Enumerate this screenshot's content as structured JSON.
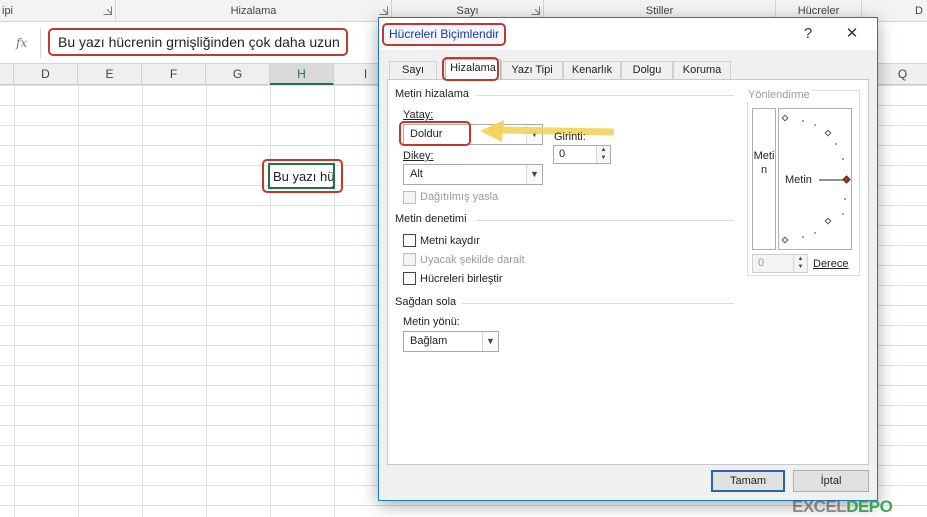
{
  "ribbon": {
    "groups": [
      {
        "label": "ipi",
        "launcher": true
      },
      {
        "label": "Hizalama",
        "launcher": true
      },
      {
        "label": "Sayı",
        "launcher": true
      },
      {
        "label": "Stiller",
        "launcher": false
      },
      {
        "label": "Hücreler",
        "launcher": false
      },
      {
        "label": "D",
        "launcher": false
      }
    ]
  },
  "formula_bar": {
    "fx_label": "fx",
    "value": "Bu yazı hücrenin grnişliğinden çok daha uzun"
  },
  "columns": [
    "D",
    "E",
    "F",
    "G",
    "H",
    "I"
  ],
  "right_columns": [
    "Q"
  ],
  "selected_column": "H",
  "active_cell": {
    "display_text": "Bu yazı hü"
  },
  "dialog": {
    "title": "Hücreleri Biçimlendir",
    "help_label": "?",
    "close_label": "✕",
    "tabs": [
      "Sayı",
      "Hizalama",
      "Yazı Tipi",
      "Kenarlık",
      "Dolgu",
      "Koruma"
    ],
    "active_tab": "Hizalama",
    "text_alignment": {
      "section_title": "Metin hizalama",
      "horizontal_label": "Yatay:",
      "horizontal_value": "Doldur",
      "indent_label": "Girinti:",
      "indent_value": "0",
      "vertical_label": "Dikey:",
      "vertical_value": "Alt",
      "justify_distributed_label": "Dağıtılmış yasla"
    },
    "text_control": {
      "section_title": "Metin denetimi",
      "wrap_text_label": "Metni kaydır",
      "shrink_to_fit_label": "Uyacak şekilde daralt",
      "merge_cells_label": "Hücreleri birleştir"
    },
    "rtl": {
      "section_title": "Sağdan sola",
      "direction_label": "Metin yönü:",
      "direction_value": "Bağlam"
    },
    "orientation": {
      "title": "Yönlendirme",
      "vertical_text": "Metin",
      "dial_text": "Metin",
      "degrees_value": "0",
      "degrees_label": "Derece"
    },
    "ok_label": "Tamam",
    "cancel_label": "İptal"
  },
  "watermark": {
    "part1": "EXCEL",
    "part2": "DEPO"
  },
  "colors": {
    "highlight": "#c0392b",
    "excel_green": "#217346",
    "dialog_border": "#1979ca",
    "arrow": "#f3d35c"
  }
}
